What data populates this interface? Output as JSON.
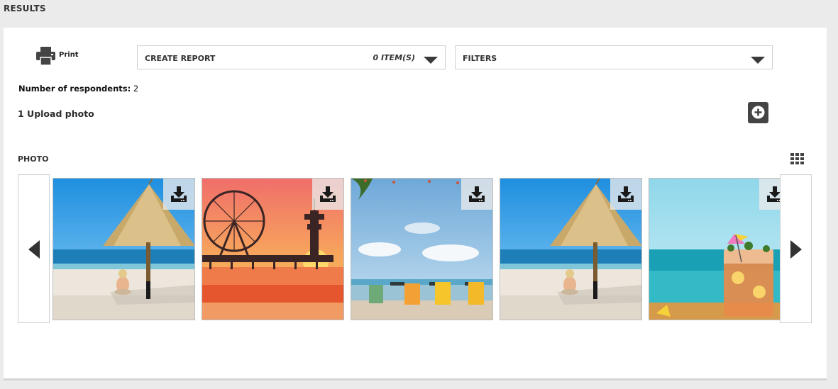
{
  "page": {
    "title": "RESULTS"
  },
  "toolbar": {
    "print_label": "Print",
    "create_report": {
      "label": "CREATE REPORT",
      "count": "0 ITEM(S)"
    },
    "filters": {
      "label": "FILTERS"
    }
  },
  "respondents": {
    "label": "Number of respondents:",
    "value": "2"
  },
  "question": {
    "title": "1 Upload photo"
  },
  "photo_section": {
    "title": "PHOTO"
  },
  "photos": [
    {
      "scene": "beach-umbrella"
    },
    {
      "scene": "pier-sunset"
    },
    {
      "scene": "beach-chairs"
    },
    {
      "scene": "beach-umbrella"
    },
    {
      "scene": "cocktail-sea"
    }
  ],
  "icons": {
    "print": "printer-icon",
    "add": "plus-circle-icon",
    "grid": "grid-view-icon",
    "download": "download-icon",
    "prev": "caret-left-icon",
    "next": "caret-right-icon"
  },
  "colors": {
    "dark": "#3f3f3f",
    "panel": "#ffffff",
    "background": "#ebebeb"
  }
}
